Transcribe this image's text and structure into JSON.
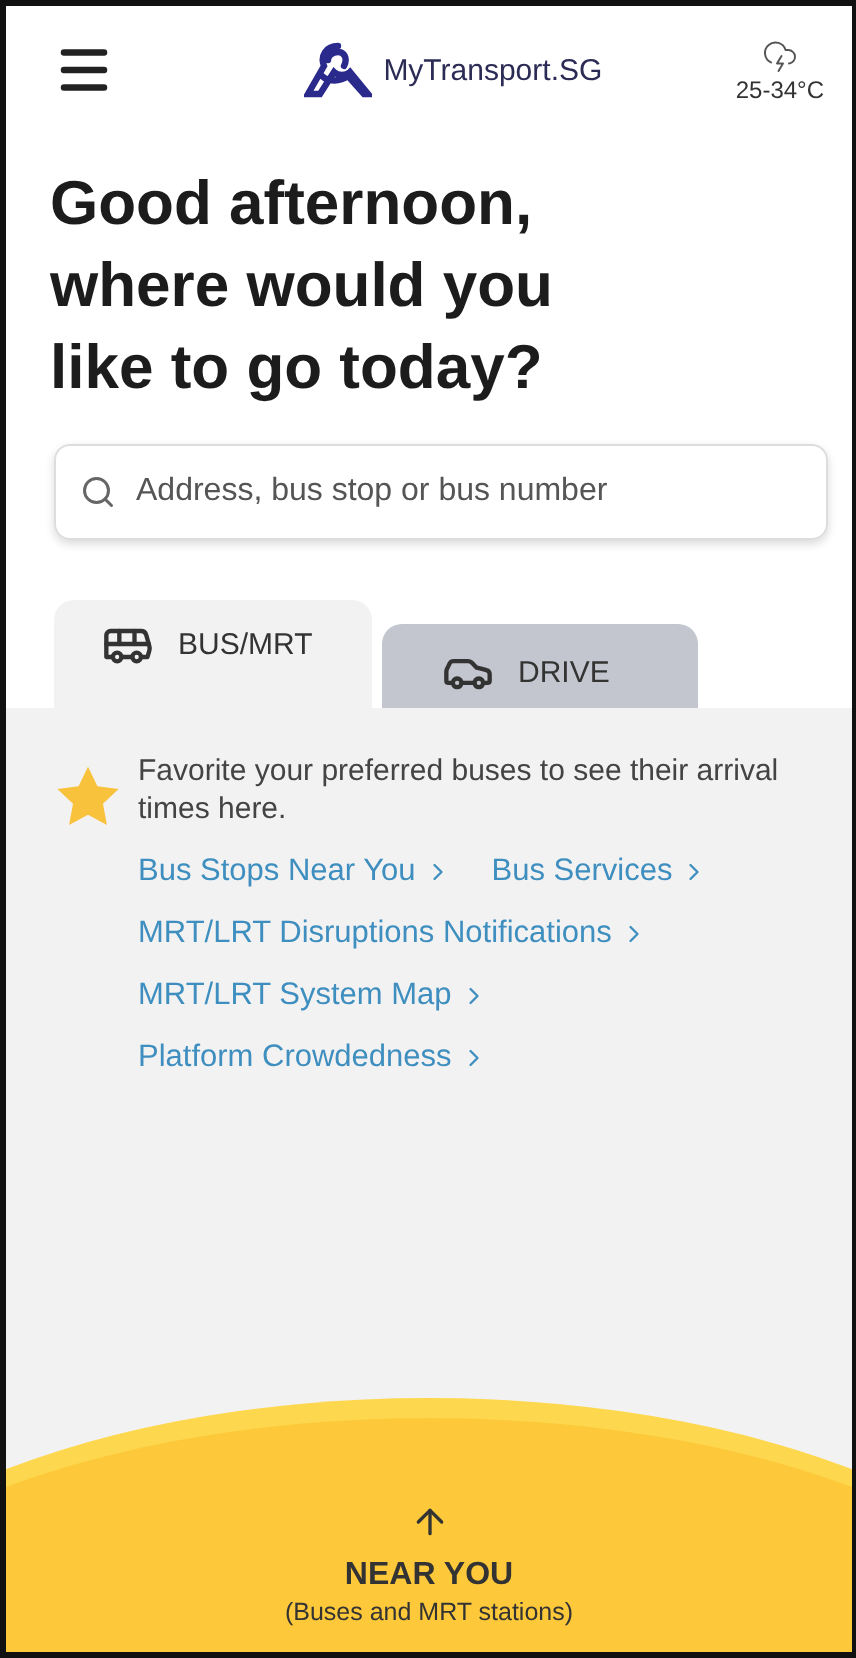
{
  "header": {
    "logo_text": "MyTransport.SG",
    "weather": "25-34°C"
  },
  "greeting": "Good afternoon, where would you like to go today?",
  "search": {
    "placeholder": "Address, bus stop or bus number"
  },
  "tabs": [
    {
      "label": "BUS/MRT",
      "kind": "bus",
      "selected": true
    },
    {
      "label": "DRIVE",
      "kind": "car",
      "selected": false
    }
  ],
  "favorites_hint": "Favorite your preferred buses to see their arrival times here.",
  "link_rows": [
    [
      "Bus Stops Near You",
      "Bus Services"
    ],
    [
      "MRT/LRT Disruptions Notifications"
    ],
    [
      "MRT/LRT System Map"
    ],
    [
      "Platform Crowdedness"
    ]
  ],
  "near_you": {
    "title": "NEAR YOU",
    "subtitle": "(Buses and MRT stations)"
  }
}
